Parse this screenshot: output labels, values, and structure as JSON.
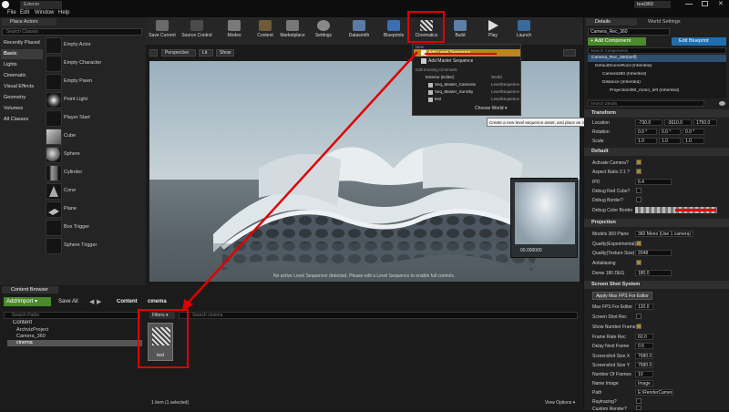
{
  "window": {
    "tab_title": "Exterior",
    "project_title": "test360"
  },
  "menu": [
    "File",
    "Edit",
    "Window",
    "Help"
  ],
  "place_actors": {
    "tab": "Place Actors",
    "search_placeholder": "Search Classes",
    "categories": [
      "Recently Placed",
      "Basic",
      "Lights",
      "Cinematic",
      "Visual Effects",
      "Geometry",
      "Volumes",
      "All Classes"
    ],
    "selected_category": "Basic",
    "actors": [
      "Empty Actor",
      "Empty Character",
      "Empty Pawn",
      "Point Light",
      "Player Start",
      "Cube",
      "Sphere",
      "Cylinder",
      "Cone",
      "Plane",
      "Box Trigger",
      "Sphere Trigger"
    ]
  },
  "toolbar": [
    "Save Current",
    "Source Control",
    "Modes",
    "Content",
    "Marketplace",
    "Settings",
    "Datasmith",
    "Blueprints",
    "Cinematics",
    "Build",
    "Play",
    "Launch"
  ],
  "viewport": {
    "perspective": "Perspective",
    "lit": "Lit",
    "show": "Show",
    "status": "No active Level Sequencer detected. Please edit a Level Sequence to enable full controls.",
    "pip_label": "00.000000"
  },
  "cinematics_menu": {
    "header_new": "New",
    "add_level": "Add Level Sequence",
    "add_master": "Add Master Sequence",
    "header_edit": "Edit Existing Cinematic",
    "tree": [
      {
        "name": "Exterior (Editor)",
        "type": "World"
      },
      {
        "name": "Seq_Master_Cameras",
        "type": "LevelSequence"
      },
      {
        "name": "Seq_Master_SunSky",
        "type": "LevelSequence"
      },
      {
        "name": "test",
        "type": "LevelSequence"
      }
    ],
    "choose_world": "Choose World",
    "tooltip": "Create a new level sequence asset, and place an instance of it in this level"
  },
  "details": {
    "tab_details": "Details",
    "tab_world": "World Settings",
    "actor_name": "Camera_Rec_360",
    "add_component": "+ Add Component",
    "edit_blueprint": "Edit Blueprint",
    "search_components": "Search Components",
    "components": [
      "Camera_Rec_360(self)",
      "DefaultSceneRoot (Inherited)",
      "Camera360 (Inherited)",
      "Distance (Inherited)",
      "Projection360_mono_left (Inherited)"
    ],
    "search_details": "Search Details",
    "transform_header": "Transform",
    "location": {
      "label": "Location",
      "x": "-730.0",
      "y": "-3610.0",
      "z": "1750.0"
    },
    "rotation": {
      "label": "Rotation",
      "x": "0.0 °",
      "y": "0.0 °",
      "z": "0.0 °"
    },
    "scale": {
      "label": "Scale",
      "x": "1.0",
      "y": "1.0",
      "z": "1.0"
    },
    "default_header": "Default",
    "default_props": [
      {
        "label": "Activate Camera?",
        "type": "checkbox",
        "value": "checked"
      },
      {
        "label": "Aspect Ratio 2:1 ?",
        "type": "checkbox",
        "value": "checked"
      },
      {
        "label": "IPD",
        "type": "value",
        "value": "6.4"
      },
      {
        "label": "Debug Red Cube?",
        "type": "checkbox",
        "value": "unchecked"
      },
      {
        "label": "Debug Border?",
        "type": "checkbox",
        "value": "unchecked"
      },
      {
        "label": "Debug Color Border",
        "type": "color",
        "value": ""
      }
    ],
    "projection_header": "Projection",
    "projection_props": [
      {
        "label": "Models 360 Plane",
        "type": "select",
        "value": "360 Mono (Use 1 camera)"
      },
      {
        "label": "Quality(Experimental)",
        "type": "checkbox",
        "value": "checked"
      },
      {
        "label": "Quality(Texture Size)",
        "type": "value",
        "value": "2048"
      },
      {
        "label": "Antialiasing",
        "type": "checkbox",
        "value": "checked"
      },
      {
        "label": "Dome 180 DEG",
        "type": "value",
        "value": "180.0"
      }
    ],
    "screenshot_header": "Screen Shot System",
    "apply_button": "Apply Max FPS For Editor",
    "screenshot_props": [
      {
        "label": "Max FPS For Editor",
        "type": "value",
        "value": "120.0"
      },
      {
        "label": "Screen Shot Rec",
        "type": "checkbox",
        "value": "unchecked"
      },
      {
        "label": "Show Number Frame",
        "type": "checkbox",
        "value": "checked"
      },
      {
        "label": "Frame Rate Rec",
        "type": "value",
        "value": "60.0"
      },
      {
        "label": "Delay Next Frame",
        "type": "value",
        "value": "0.5"
      },
      {
        "label": "Screenshot Size X",
        "type": "value",
        "value": "7680.0"
      },
      {
        "label": "Screenshot Size Y",
        "type": "value",
        "value": "7680.0"
      },
      {
        "label": "Number Of Frames",
        "type": "value",
        "value": "10"
      },
      {
        "label": "Name Image",
        "type": "value",
        "value": "Image"
      },
      {
        "label": "Path",
        "type": "value",
        "value": "E:\\RenderCamera360"
      },
      {
        "label": "Raytracing?",
        "type": "checkbox",
        "value": "unchecked"
      },
      {
        "label": "Custom Render?",
        "type": "checkbox",
        "value": "unchecked"
      }
    ]
  },
  "content_browser": {
    "tab": "Content Browser",
    "add_import": "Add/Import",
    "save_all": "Save All",
    "path": [
      "Content",
      "cinema"
    ],
    "search_paths": "Search Paths",
    "filters": "Filters",
    "search_placeholder": "Search cinema",
    "tree": [
      "Content",
      "ArchvizProject",
      "Camera_360",
      "cinema"
    ],
    "asset_name": "test",
    "status": "1 item (1 selected)",
    "view_options": "View Options"
  },
  "colors": {
    "accent_green": "#4a8a2a",
    "blue_button": "#1f6fb0",
    "highlight_red": "#e00000",
    "menu_highlight": "#b8861c"
  }
}
